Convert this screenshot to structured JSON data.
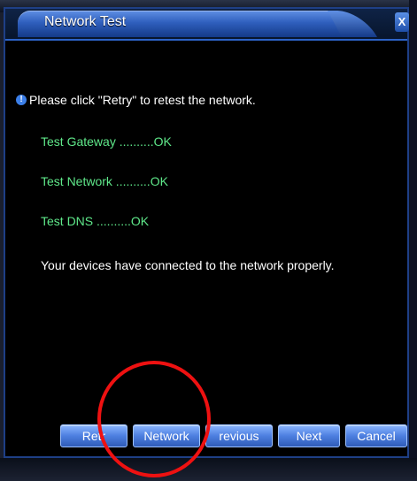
{
  "window": {
    "title": "Network Test",
    "close_label": "X"
  },
  "content": {
    "info_message": "Please click \"Retry\" to retest the network.",
    "tests": [
      {
        "label": "Test Gateway ..........OK"
      },
      {
        "label": "Test Network ..........OK"
      },
      {
        "label": "Test DNS ..........OK"
      }
    ],
    "result_message": "Your devices have connected to the network properly."
  },
  "buttons": {
    "retry": "Retr",
    "network": "Network",
    "previous": "revious",
    "next": "Next",
    "cancel": "Cancel"
  },
  "colors": {
    "accent": "#2f5fbd",
    "status_ok": "#5fe88a",
    "annotation": "#ee1111"
  }
}
